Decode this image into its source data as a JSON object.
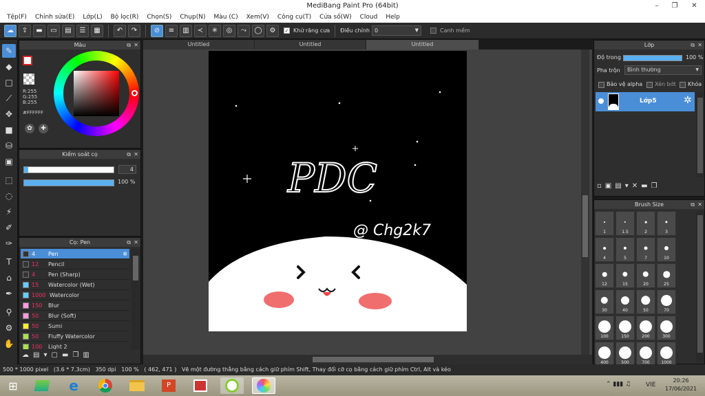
{
  "window": {
    "title": "MediBang Paint Pro (64bit)",
    "min": "–",
    "max": "❐",
    "close": "✕"
  },
  "menu": [
    "Tệp(F)",
    "Chỉnh sửa(E)",
    "Lớp(L)",
    "Bộ lọc(R)",
    "Chọn(S)",
    "Chụp(N)",
    "Màu (C)",
    "Xem(V)",
    "Công cụ(T)",
    "Cửa số(W)",
    "Cloud",
    "Help"
  ],
  "toolbar": {
    "antialias_label": "Khử răng cưa",
    "adjust_label": "Điều chỉnh",
    "adjust_value": "0",
    "edge_label": "Canh mềm"
  },
  "tabs": [
    "Untitled",
    "Untitled",
    "Untitled"
  ],
  "color_panel": {
    "title": "Màu",
    "r": "R:255",
    "g": "G:255",
    "b": "B:255",
    "hex": "#FFFFFF"
  },
  "brush_control": {
    "title": "Kiểm soát cọ",
    "size": "4",
    "opacity": "100 %"
  },
  "brush_list": {
    "title": "Cọ: Pen",
    "items": [
      {
        "size": "4",
        "name": "Pen",
        "color": "#333333"
      },
      {
        "size": "12",
        "name": "Pencil",
        "color": "#333333"
      },
      {
        "size": "4",
        "name": "Pen (Sharp)",
        "color": "#333333"
      },
      {
        "size": "15",
        "name": "Watercolor (Wet)",
        "color": "#66ccff"
      },
      {
        "size": "1000",
        "name": "Watercolor",
        "color": "#66ccff"
      },
      {
        "size": "150",
        "name": "Blur",
        "color": "#ff99dd"
      },
      {
        "size": "50",
        "name": "Blur (Soft)",
        "color": "#ff99dd"
      },
      {
        "size": "50",
        "name": "Sumi",
        "color": "#ffee33"
      },
      {
        "size": "50",
        "name": "Fluffy Watercolor",
        "color": "#aadd55"
      },
      {
        "size": "100",
        "name": "Light 2",
        "color": "#aadd55"
      }
    ]
  },
  "layer_panel": {
    "title": "Lớp",
    "opacity_label": "Độ trong",
    "opacity_value": "100 %",
    "blend_label": "Pha trộn",
    "blend_value": "Bình thường",
    "protect_alpha": "Bảo vệ alpha",
    "clip": "Xén bớt",
    "lock": "Khóa",
    "layer_name": "Lớp5"
  },
  "brush_size_panel": {
    "title": "Brush Size",
    "sizes": [
      "1",
      "1.5",
      "2",
      "3",
      "4",
      "5",
      "7",
      "10",
      "12",
      "15",
      "20",
      "25",
      "30",
      "40",
      "50",
      "70",
      "100",
      "150",
      "200",
      "300",
      "400",
      "500",
      "700",
      "1000"
    ]
  },
  "artwork": {
    "title_text": "PDC",
    "signature": "@ Chg2k7"
  },
  "status": {
    "dims": "500 * 1000 pixel",
    "cm": "(3.6 * 7.3cm)",
    "dpi": "350 dpi",
    "zoom": "100 %",
    "coords": "( 462, 471 )",
    "hint": "Vẽ một đường thẳng bằng cách giữ phím Shift, Thay đổi cỡ cọ bằng cách giữ phím Ctrl, Alt và kéo"
  },
  "taskbar": {
    "lang": "VIE",
    "time": "20:26",
    "date": "17/06/2021"
  },
  "colors": {
    "accent": "#4b8ed8",
    "panel": "#2e2e2e",
    "canvas_bg": "#000000",
    "blush": "#ee5555"
  }
}
